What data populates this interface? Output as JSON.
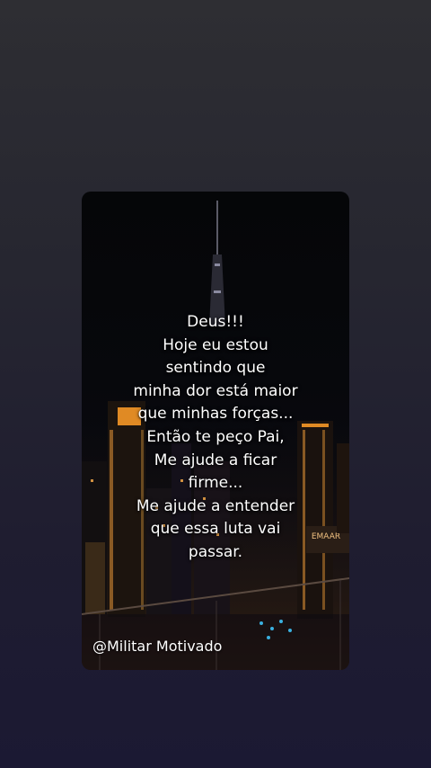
{
  "quote": {
    "lines": [
      "Deus!!!",
      "Hoje eu estou",
      "sentindo que",
      "minha dor está maior",
      "que minhas forças...",
      "Então te peço Pai,",
      "Me ajude a ficar",
      "firme...",
      "Me ajude a entender",
      "que essa luta vai",
      "passar."
    ]
  },
  "author_handle": "@Militar Motivado",
  "building_sign": "EMAAR",
  "colors": {
    "background_top": "#2e2e33",
    "background_bottom": "#1b1933",
    "text": "#ffffff",
    "city_lights": "#f0a040"
  }
}
